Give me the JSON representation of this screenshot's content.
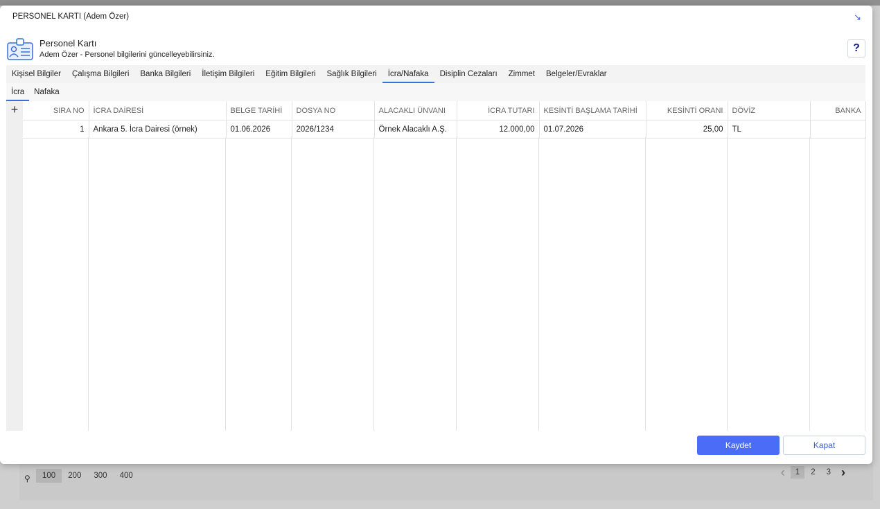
{
  "dialog": {
    "title": "PERSONEL KARTI (Adem Özer)",
    "collapse_icon": "↘"
  },
  "header": {
    "icon": "id-card-icon",
    "title": "Personel Kartı",
    "subtitle": "Adem Özer - Personel bilgilerini güncelleyebilirsiniz.",
    "help_label": "?"
  },
  "tabs": [
    {
      "label": "Kişisel Bilgiler",
      "active": false
    },
    {
      "label": "Çalışma Bilgileri",
      "active": false
    },
    {
      "label": "Banka Bilgileri",
      "active": false
    },
    {
      "label": "İletişim Bilgileri",
      "active": false
    },
    {
      "label": "Eğitim Bilgileri",
      "active": false
    },
    {
      "label": "Sağlık Bilgileri",
      "active": false
    },
    {
      "label": "İcra/Nafaka",
      "active": true
    },
    {
      "label": "Disiplin Cezaları",
      "active": false
    },
    {
      "label": "Zimmet",
      "active": false
    },
    {
      "label": "Belgeler/Evraklar",
      "active": false
    }
  ],
  "subtabs": [
    {
      "label": "İcra",
      "active": true
    },
    {
      "label": "Nafaka",
      "active": false
    }
  ],
  "grid": {
    "add_label": "+",
    "columns": [
      "SIRA NO",
      "İCRA DAİRESİ",
      "BELGE TARİHİ",
      "DOSYA NO",
      "ALACAKLI ÜNVANI",
      "İCRA TUTARI",
      "KESİNTİ BAŞLAMA TARİHİ",
      "KESİNTİ ORANI",
      "DÖVİZ",
      "BANKA"
    ],
    "rows": [
      [
        "1",
        "Ankara 5. İcra Dairesi (örnek)",
        "01.06.2026",
        "2026/1234",
        "Örnek Alacaklı A.Ş.",
        "12.000,00",
        "01.07.2026",
        "25,00",
        "TL",
        ""
      ]
    ]
  },
  "footer": {
    "save_label": "Kaydet",
    "close_label": "Kapat"
  },
  "pager": {
    "sizes": [
      "100",
      "200",
      "300",
      "400"
    ],
    "active_size": "100",
    "pages": [
      "1",
      "2",
      "3"
    ],
    "active_page": "1"
  },
  "colors": {
    "accent": "#4a6cf7",
    "tab_underline": "#3a6fd8"
  }
}
